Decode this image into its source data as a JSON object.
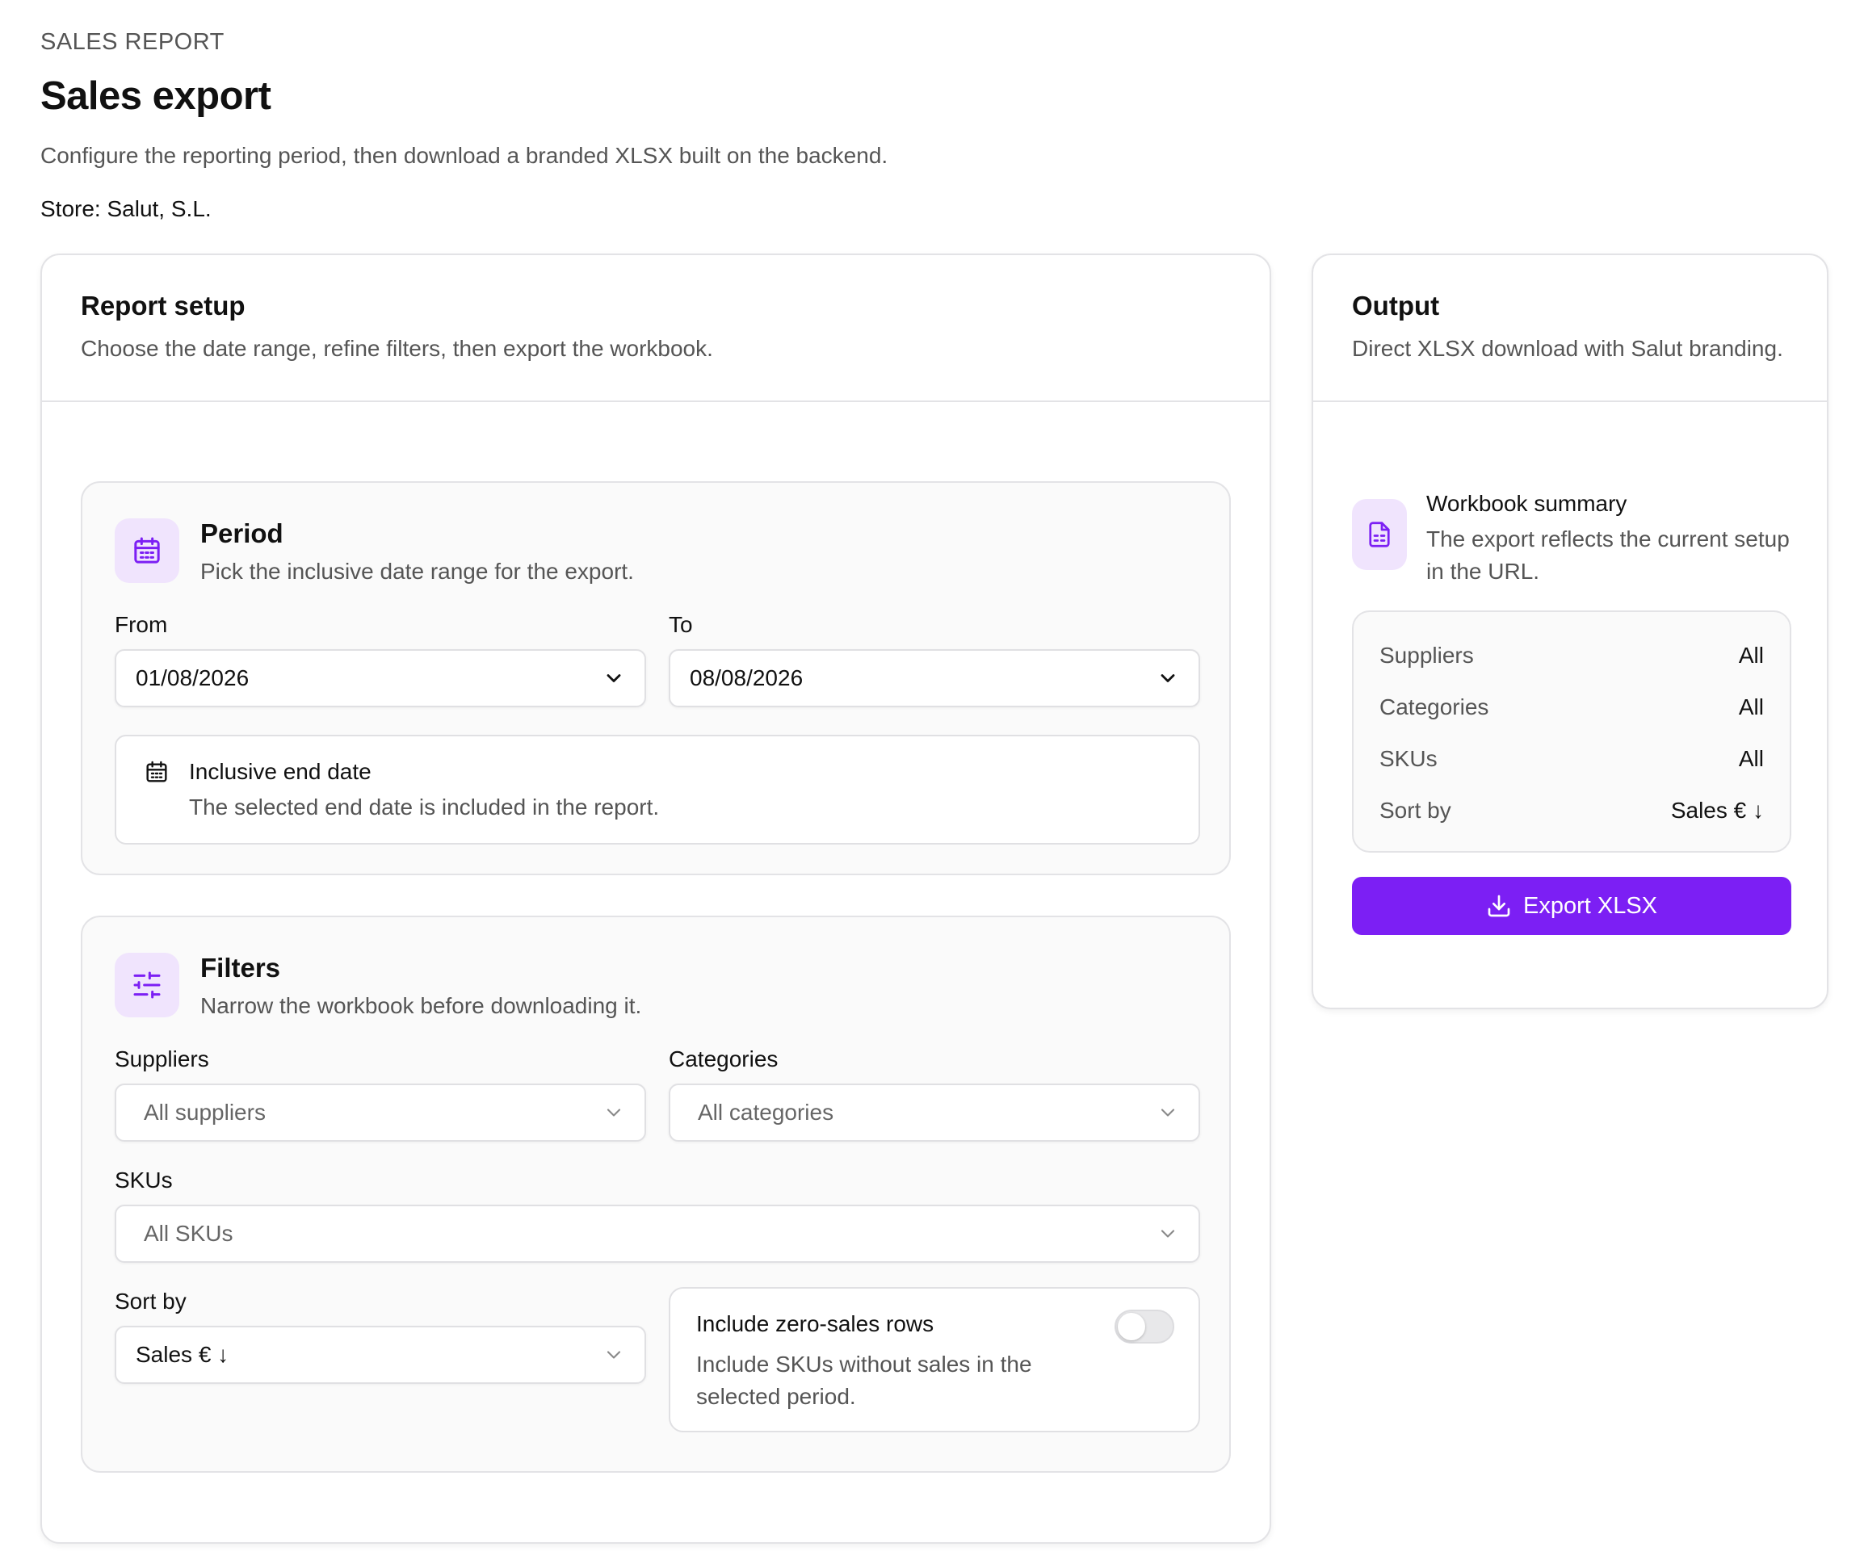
{
  "header": {
    "eyebrow": "SALES REPORT",
    "title": "Sales export",
    "subtitle": "Configure the reporting period, then download a branded XLSX built on the backend.",
    "store": "Store: Salut, S.L."
  },
  "setup": {
    "title": "Report setup",
    "description": "Choose the date range, refine filters, then export the workbook.",
    "period": {
      "icon": "calendar-icon",
      "title": "Period",
      "description": "Pick the inclusive date range for the export.",
      "from_label": "From",
      "from_value": "01/08/2026",
      "to_label": "To",
      "to_value": "08/08/2026",
      "info_title": "Inclusive end date",
      "info_desc": "The selected end date is included in the report."
    },
    "filters": {
      "icon": "sliders-icon",
      "title": "Filters",
      "description": "Narrow the workbook before downloading it.",
      "suppliers_label": "Suppliers",
      "suppliers_value": "All suppliers",
      "categories_label": "Categories",
      "categories_value": "All categories",
      "skus_label": "SKUs",
      "skus_value": "All SKUs",
      "sort_label": "Sort by",
      "sort_value": "Sales € ↓",
      "zero_title": "Include zero-sales rows",
      "zero_desc": "Include SKUs without sales in the selected period.",
      "zero_enabled": false
    }
  },
  "output": {
    "title": "Output",
    "description": "Direct XLSX download with Salut branding.",
    "summary_title": "Workbook summary",
    "summary_desc": "The export reflects the current setup in the URL.",
    "rows": [
      {
        "key": "Suppliers",
        "value": "All"
      },
      {
        "key": "Categories",
        "value": "All"
      },
      {
        "key": "SKUs",
        "value": "All"
      },
      {
        "key": "Sort by",
        "value": "Sales € ↓"
      }
    ],
    "export_label": "Export XLSX"
  },
  "colors": {
    "accent": "#7c1ff4",
    "icon_bg": "#f0e4fd",
    "border": "#e3e3e6"
  }
}
